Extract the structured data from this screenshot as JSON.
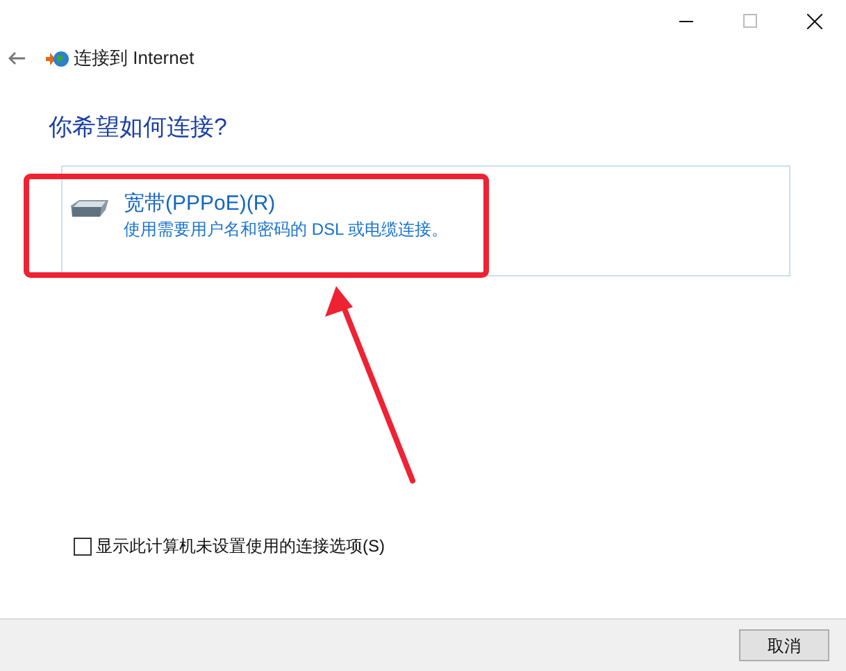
{
  "window": {
    "title": "连接到 Internet"
  },
  "heading": "你希望如何连接?",
  "options": [
    {
      "title": "宽带(PPPoE)(R)",
      "description": "使用需要用户名和密码的 DSL 或电缆连接。",
      "kind": "broadband"
    }
  ],
  "show_unconfigured": {
    "label": "显示此计算机未设置使用的连接选项(S)",
    "checked": false
  },
  "buttons": [
    "取消"
  ]
}
